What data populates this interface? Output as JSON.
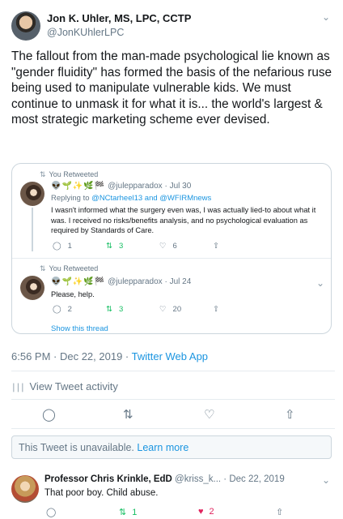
{
  "tweet": {
    "author_name": "Jon K. Uhler, MS, LPC, CCTP",
    "author_handle": "@JonKUhlerLPC",
    "text": "The fallout from the man-made psychological lie known as \"gender fluidity\" has formed the basis of the nefarious ruse being used to manipulate vulnerable kids. We must continue to unmask it for what it is... the world's largest & most strategic marketing scheme ever devised.",
    "timestamp": "6:56 PM · Dec 22, 2019 · ",
    "source": "Twitter Web App",
    "view_activity": "View Tweet activity",
    "menu_icon": "chevron-down-icon"
  },
  "thread": {
    "items": [
      {
        "retweet_label": "You Retweeted",
        "emoji": "👽🌱✨🌿🏁",
        "name": "@julepparadox · Jul 30",
        "replying_to_prefix": "Replying to ",
        "replying_to_links": "@NCtarheel13 and @WFIRMnews",
        "text": "I wasn't informed what the surgery even was, I was actually lied-to about what it was. I received no risks/benefits analysis, and no psychological evaluation as required by Standards of Care.",
        "replies": "1",
        "retweets": "3",
        "likes": "6"
      },
      {
        "retweet_label": "You Retweeted",
        "emoji": "👽🌱✨🌿🏁",
        "name": "@julepparadox · Jul 24",
        "text": "Please, help.",
        "replies": "2",
        "retweets": "3",
        "likes": "20"
      }
    ],
    "show_thread": "Show this thread"
  },
  "unavailable": {
    "text": "This Tweet is unavailable. ",
    "link": "Learn more"
  },
  "reply": {
    "name": "Professor Chris Krinkle, EdD",
    "meta": " @kriss_k... · Dec 22, 2019",
    "text": "That poor boy. Child abuse.",
    "retweets": "1",
    "likes": "2"
  },
  "colors": {
    "link": "#1b95e0",
    "retweet_green": "#17bf63",
    "like_red": "#e0245e",
    "muted": "#657786"
  }
}
